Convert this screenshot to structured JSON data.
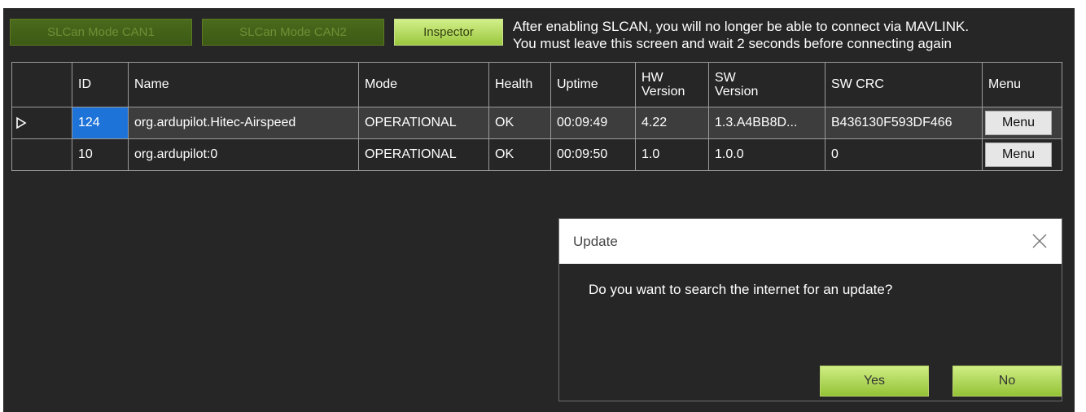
{
  "toolbar": {
    "slcan_can1_label": "SLCan Mode CAN1",
    "slcan_can2_label": "SLCan Mode CAN2",
    "inspector_label": "Inspector"
  },
  "warning": {
    "line1": "After enabling SLCAN, you will no longer be able to connect via MAVLINK.",
    "line2": "You must leave this screen and wait 2 seconds before connecting again"
  },
  "table": {
    "headers": {
      "id": "ID",
      "name": "Name",
      "mode": "Mode",
      "health": "Health",
      "uptime": "Uptime",
      "hw_version_1": "HW",
      "hw_version_2": "Version",
      "sw_version_1": "SW",
      "sw_version_2": "Version",
      "sw_crc": "SW CRC",
      "menu": "Menu"
    },
    "rows": [
      {
        "id": "124",
        "name": "org.ardupilot.Hitec-Airspeed",
        "mode": "OPERATIONAL",
        "health": "OK",
        "uptime": "00:09:49",
        "hw_version": "4.22",
        "sw_version": "1.3.A4BB8D...",
        "sw_crc": "B436130F593DF466",
        "menu": "Menu"
      },
      {
        "id": "10",
        "name": "org.ardupilot:0",
        "mode": "OPERATIONAL",
        "health": "OK",
        "uptime": "00:09:50",
        "hw_version": "1.0",
        "sw_version": "1.0.0",
        "sw_crc": "0",
        "menu": "Menu"
      }
    ]
  },
  "dialog": {
    "title": "Update",
    "message": "Do you want to search the internet for an update?",
    "yes_label": "Yes",
    "no_label": "No"
  }
}
